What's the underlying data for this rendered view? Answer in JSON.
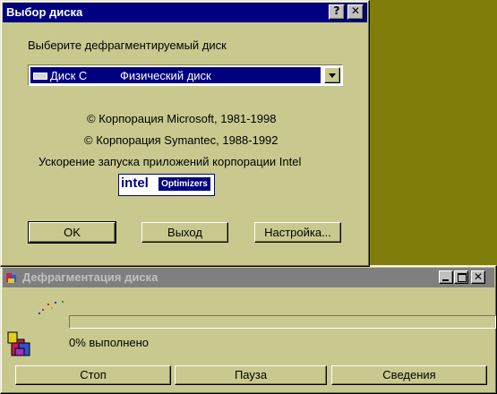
{
  "desktop_color": "#807d0a",
  "select_dialog": {
    "title": "Выбор диска",
    "help_btn": "?",
    "close_btn": "✕",
    "prompt": "Выберите дефрагментируемый диск",
    "drive_select": {
      "drive": "Диск C",
      "type": "Физический диск"
    },
    "copyright_ms": "© Корпорация Microsoft, 1981-1998",
    "copyright_sym": "© Корпорация Symantec, 1988-1992",
    "intel_text": "Ускорение запуска приложений корпорации Intel",
    "intel_logo": {
      "brand": "intel",
      "product": "Optimizers"
    },
    "buttons": {
      "ok": "OK",
      "exit": "Выход",
      "settings": "Настройка..."
    }
  },
  "defrag_window": {
    "title": "Дефрагментация диска",
    "progress_percent": 0,
    "progress_text": "0% выполнено",
    "buttons": {
      "stop": "Стоп",
      "pause": "Пауза",
      "details": "Сведения"
    }
  },
  "accent": {
    "titlebar_active": "#000080",
    "titlebar_inactive": "#7f7f7f",
    "window_bg": "#c9c98f"
  }
}
